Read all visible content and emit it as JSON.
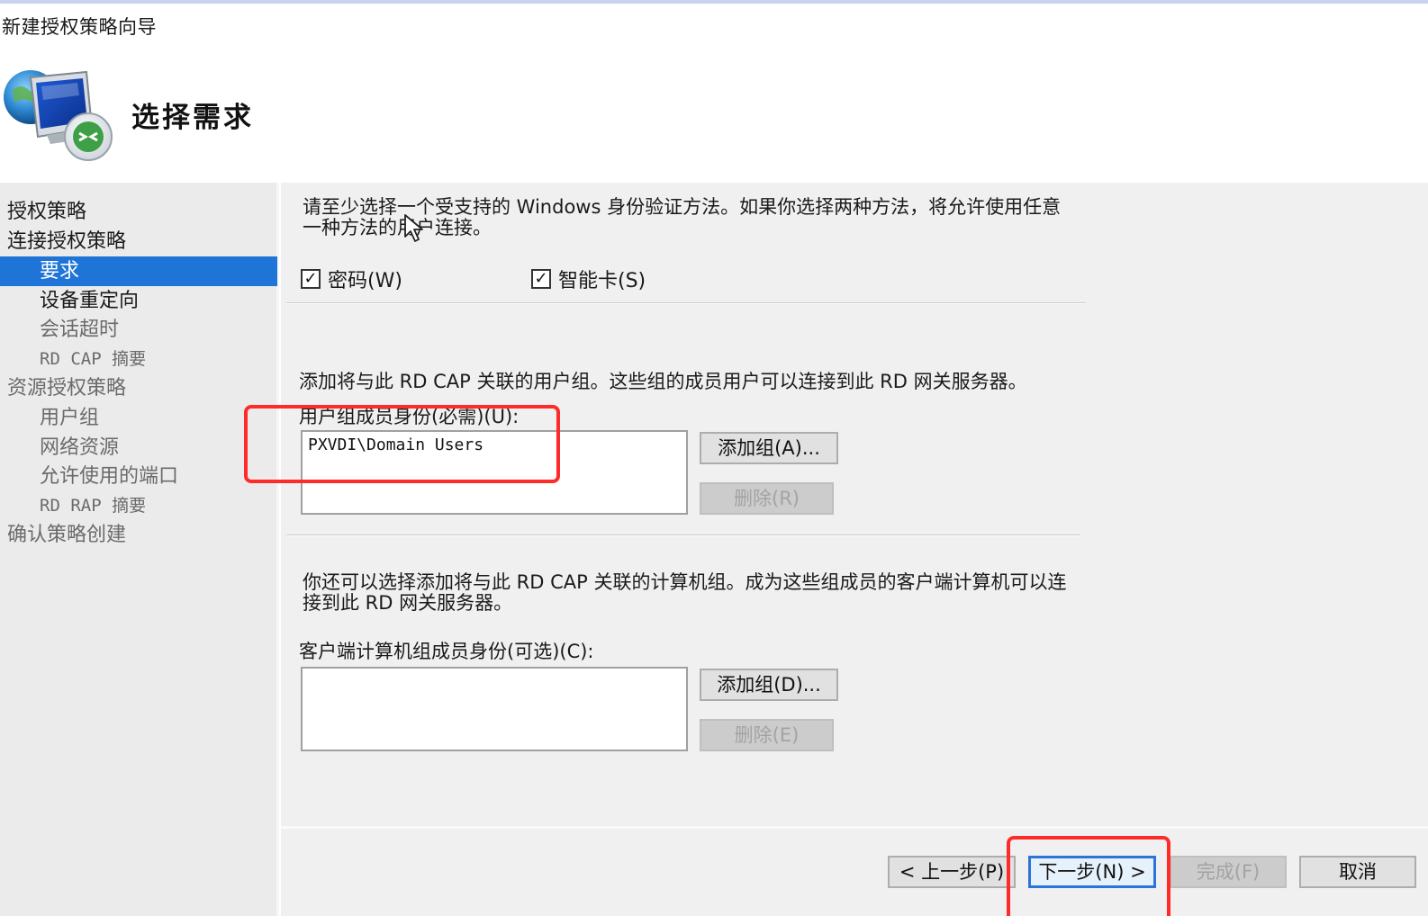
{
  "window": {
    "title": "新建授权策略向导"
  },
  "header": {
    "page_title": "选择需求"
  },
  "sidebar": {
    "items": [
      {
        "label": "授权策略",
        "level": 1,
        "state": "normal"
      },
      {
        "label": "连接授权策略",
        "level": 1,
        "state": "normal"
      },
      {
        "label": "要求",
        "level": 2,
        "state": "selected"
      },
      {
        "label": "设备重定向",
        "level": 2,
        "state": "normal"
      },
      {
        "label": "会话超时",
        "level": 2,
        "state": "dim"
      },
      {
        "label": "RD CAP 摘要",
        "level": 2,
        "state": "dim"
      },
      {
        "label": "资源授权策略",
        "level": 1,
        "state": "dim"
      },
      {
        "label": "用户组",
        "level": 2,
        "state": "dim"
      },
      {
        "label": "网络资源",
        "level": 2,
        "state": "dim"
      },
      {
        "label": "允许使用的端口",
        "level": 2,
        "state": "dim"
      },
      {
        "label": "RD RAP 摘要",
        "level": 2,
        "state": "dim"
      },
      {
        "label": "确认策略创建",
        "level": 1,
        "state": "dim"
      }
    ]
  },
  "auth": {
    "instruction": "请至少选择一个受支持的 Windows 身份验证方法。如果你选择两种方法，将允许使用任意一种方法的用户连接。",
    "password_label": "密码(W)",
    "password_checked": true,
    "smartcard_label": "智能卡(S)",
    "smartcard_checked": true
  },
  "user_groups": {
    "description": "添加将与此 RD CAP 关联的用户组。这些组的成员用户可以连接到此 RD 网关服务器。",
    "field_label": "用户组成员身份(必需)(U):",
    "members": [
      "PXVDI\\Domain Users"
    ],
    "add_button": "添加组(A)...",
    "remove_button": "删除(R)"
  },
  "computer_groups": {
    "description": "你还可以选择添加将与此 RD CAP 关联的计算机组。成为这些组成员的客户端计算机可以连接到此 RD 网关服务器。",
    "field_label": "客户端计算机组成员身份(可选)(C):",
    "members": [],
    "add_button": "添加组(D)...",
    "remove_button": "删除(E)"
  },
  "footer": {
    "back_button": "< 上一步(P)",
    "next_button": "下一步(N) >",
    "finish_button": "完成(F)",
    "cancel_button": "取消"
  },
  "colors": {
    "selection": "#1f74d8",
    "highlight_annotation": "#ff2a2a",
    "panel_background": "#f0f0f0"
  },
  "icons": {
    "header": "remote-desktop-gateway-icon",
    "checkbox": "checkmark-icon",
    "pointer": "mouse-cursor-icon"
  }
}
